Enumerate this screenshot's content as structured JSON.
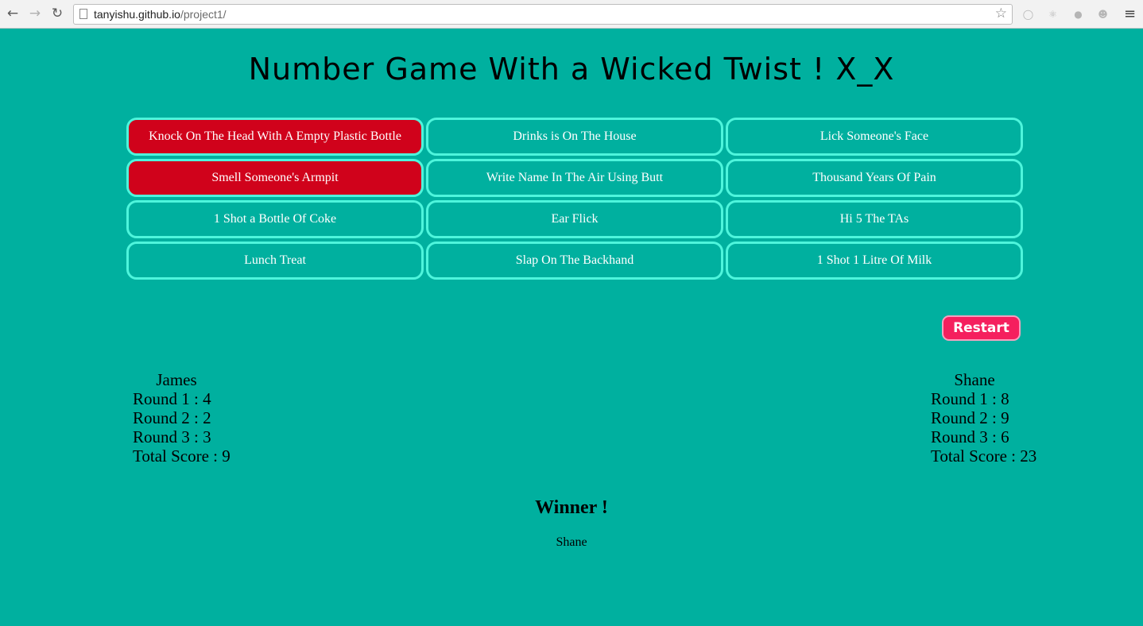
{
  "browser": {
    "url_host": "tanyishu.github.io",
    "url_path": "/project1/",
    "icons": [
      "back-icon",
      "forward-icon",
      "reload-icon",
      "page-icon",
      "star-icon",
      "menu-icon"
    ]
  },
  "page": {
    "title": "Number Game With a Wicked Twist ! X_X",
    "tiles": [
      {
        "label": "Knock On The Head With A Empty Plastic Bottle",
        "state": "revealed"
      },
      {
        "label": "Drinks is On The House",
        "state": "hidden"
      },
      {
        "label": "Lick Someone's Face",
        "state": "hidden"
      },
      {
        "label": "Smell Someone's Armpit",
        "state": "revealed"
      },
      {
        "label": "Write Name In The Air Using Butt",
        "state": "hidden"
      },
      {
        "label": "Thousand Years Of Pain",
        "state": "hidden"
      },
      {
        "label": "1 Shot a Bottle Of Coke",
        "state": "hidden"
      },
      {
        "label": "Ear Flick",
        "state": "hidden"
      },
      {
        "label": "Hi 5 The TAs",
        "state": "hidden"
      },
      {
        "label": "Lunch Treat",
        "state": "hidden"
      },
      {
        "label": "Slap On The Backhand",
        "state": "hidden"
      },
      {
        "label": "1 Shot 1 Litre Of Milk",
        "state": "hidden"
      }
    ],
    "restart_label": "Restart",
    "player1": {
      "name": "James",
      "rounds": [
        "Round 1 : 4",
        "Round 2 : 2",
        "Round 3 : 3"
      ],
      "total": "Total Score : 9"
    },
    "player2": {
      "name": "Shane",
      "rounds": [
        "Round 1 : 8",
        "Round 2 : 9",
        "Round 3 : 6"
      ],
      "total": "Total Score : 23"
    },
    "winner_title": "Winner !",
    "winner_name": "Shane"
  },
  "colors": {
    "background": "#00b09f",
    "tile_border": "#4ef5dc",
    "revealed_tile": "#d0021b",
    "restart": "#f51f5e"
  }
}
